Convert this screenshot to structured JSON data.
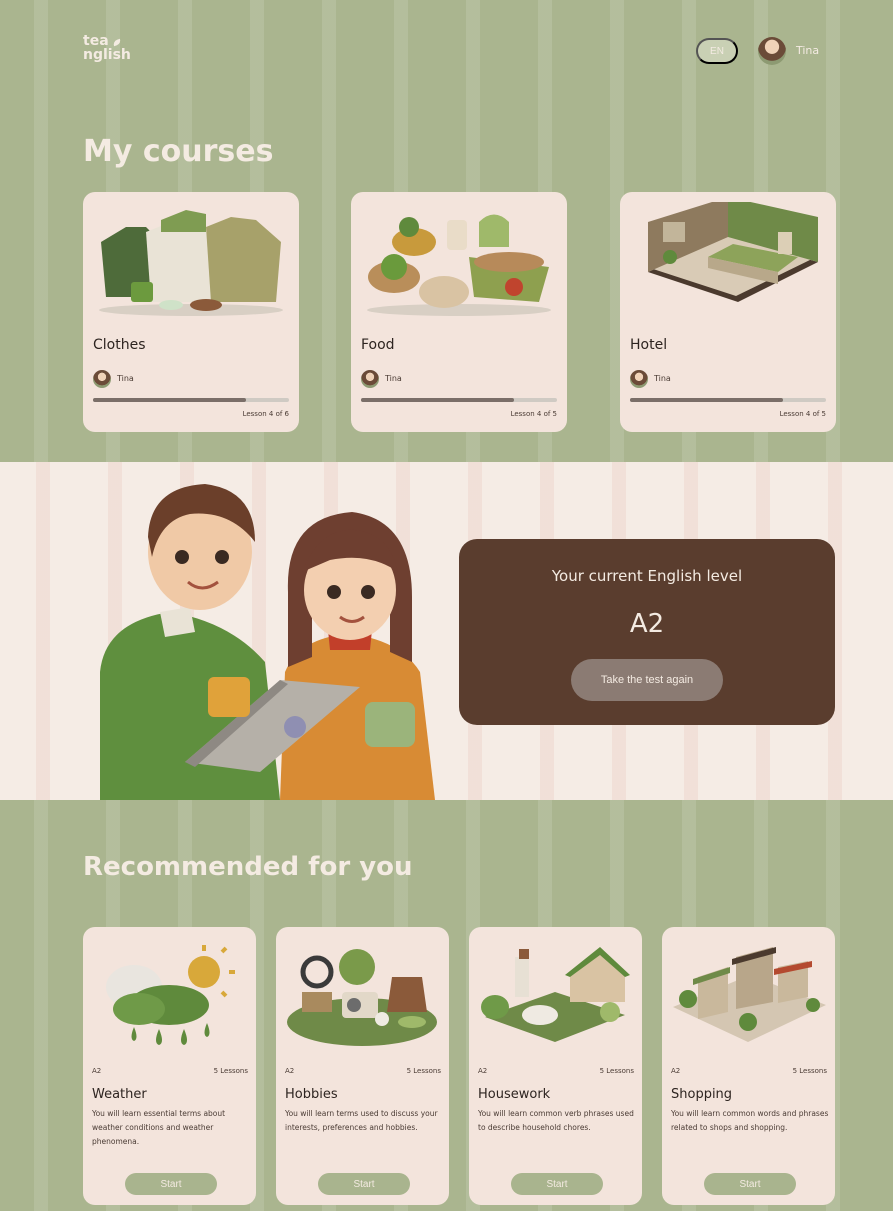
{
  "header": {
    "logo_line1": "tea",
    "logo_line2": "nglish",
    "language": "EN",
    "user_name": "Tina"
  },
  "my_courses": {
    "heading": "My courses",
    "cards": [
      {
        "title": "Clothes",
        "author": "Tina",
        "lesson_text": "Lesson 4 of 6",
        "progress": 0.78,
        "icon": "clothes-illustration"
      },
      {
        "title": "Food",
        "author": "Tina",
        "lesson_text": "Lesson 4 of 5",
        "progress": 0.78,
        "icon": "food-illustration"
      },
      {
        "title": "Hotel",
        "author": "Tina",
        "lesson_text": "Lesson 4 of 5",
        "progress": 0.78,
        "icon": "hotel-illustration"
      }
    ]
  },
  "level": {
    "label": "Your current English level",
    "value": "A2",
    "retake_label": "Take the test again"
  },
  "recommended": {
    "heading": "Recommended for you",
    "cards": [
      {
        "level": "A2",
        "lessons": "5 Lessons",
        "title": "Weather",
        "description": "You will learn essential terms about weather conditions and weather phenomena.",
        "start_label": "Start",
        "icon": "weather-illustration"
      },
      {
        "level": "A2",
        "lessons": "5 Lessons",
        "title": "Hobbies",
        "description": "You will learn terms used to discuss your interests, preferences and hobbies.",
        "start_label": "Start",
        "icon": "hobbies-illustration"
      },
      {
        "level": "A2",
        "lessons": "5 Lessons",
        "title": "Housework",
        "description": "You will learn common verb phrases used to describe household chores.",
        "start_label": "Start",
        "icon": "housework-illustration"
      },
      {
        "level": "A2",
        "lessons": "5 Lessons",
        "title": "Shopping",
        "description": "You will learn common words and phrases related to shops and shopping.",
        "start_label": "Start",
        "icon": "shopping-illustration"
      }
    ]
  },
  "colors": {
    "sage": "#aab58f",
    "card": "#f3e4dc",
    "brown": "#5a3d2e",
    "cream": "#f4ebe2"
  }
}
